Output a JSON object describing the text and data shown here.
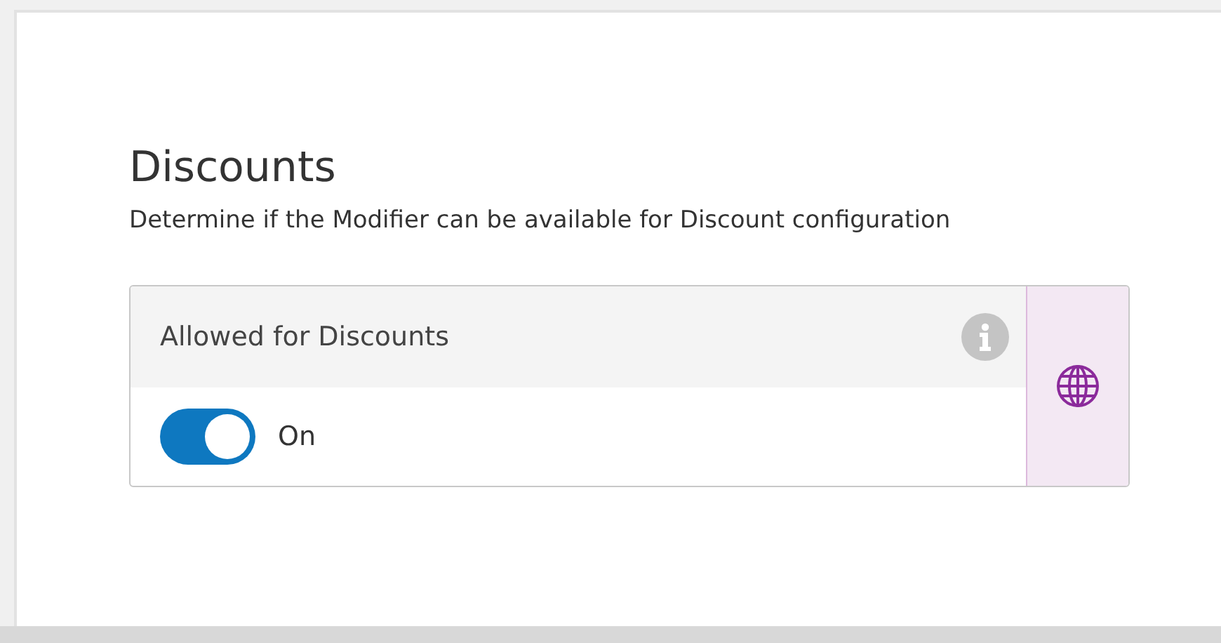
{
  "section": {
    "title": "Discounts",
    "description": "Determine if the Modifier can be available for Discount configuration"
  },
  "setting": {
    "label": "Allowed for Discounts",
    "toggle": {
      "on": true,
      "label": "On"
    }
  }
}
